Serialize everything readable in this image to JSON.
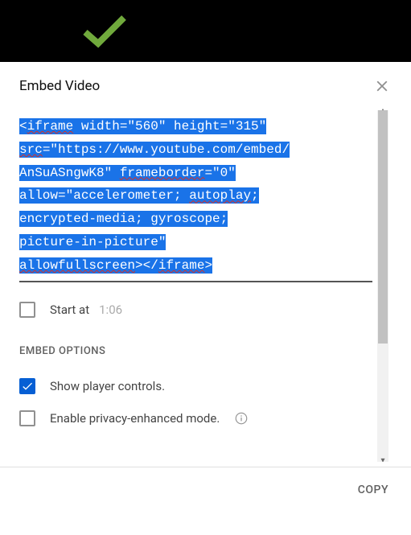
{
  "topbar": {
    "checkmark_color": "#6cb33f"
  },
  "dialog": {
    "title": "Embed Video",
    "embed_code": "<iframe width=\"560\" height=\"315\" src=\"https://www.youtube.com/embed/AnSuASngwK8\" frameborder=\"0\" allow=\"accelerometer; autoplay; encrypted-media; gyroscope; picture-in-picture\" allowfullscreen></iframe>",
    "start_at": {
      "label": "Start at",
      "time": "1:06",
      "checked": false
    },
    "section_heading": "EMBED OPTIONS",
    "options": {
      "player_controls": {
        "label": "Show player controls.",
        "checked": true
      },
      "privacy_mode": {
        "label": "Enable privacy-enhanced mode.",
        "checked": false
      }
    },
    "copy_label": "COPY"
  }
}
